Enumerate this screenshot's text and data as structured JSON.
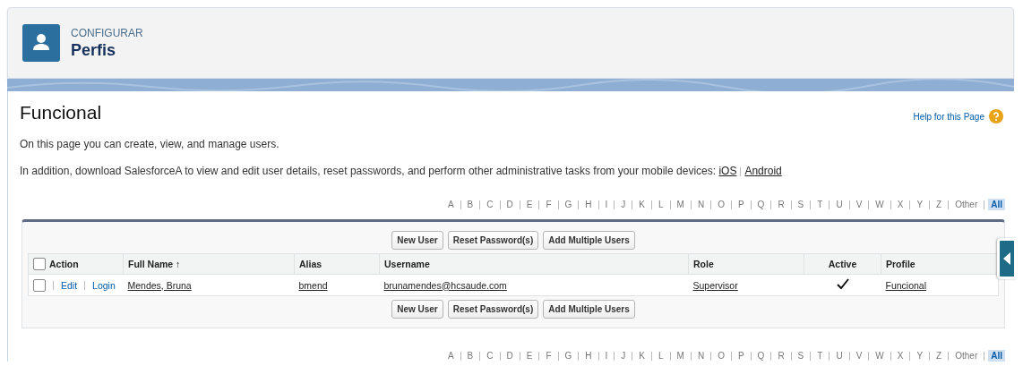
{
  "header": {
    "section": "CONFIGURAR",
    "title": "Perfis"
  },
  "page": {
    "title": "Funcional",
    "help_link": "Help for this Page",
    "intro": "On this page you can create, view, and manage users.",
    "mobile_text": "In addition, download SalesforceA to view and edit user details, reset passwords, and perform other administrative tasks from your mobile devices:",
    "mobile_links": [
      "iOS",
      "Android"
    ]
  },
  "alphabet_top": [
    {
      "label": "A",
      "selected": false
    },
    {
      "label": "B",
      "selected": false
    },
    {
      "label": "C",
      "selected": false
    },
    {
      "label": "D",
      "selected": false
    },
    {
      "label": "E",
      "selected": false
    },
    {
      "label": "F",
      "selected": false
    },
    {
      "label": "G",
      "selected": false
    },
    {
      "label": "H",
      "selected": false
    },
    {
      "label": "I",
      "selected": false
    },
    {
      "label": "J",
      "selected": false
    },
    {
      "label": "K",
      "selected": false
    },
    {
      "label": "L",
      "selected": false
    },
    {
      "label": "M",
      "selected": false
    },
    {
      "label": "N",
      "selected": false
    },
    {
      "label": "O",
      "selected": false
    },
    {
      "label": "P",
      "selected": false
    },
    {
      "label": "Q",
      "selected": false
    },
    {
      "label": "R",
      "selected": false
    },
    {
      "label": "S",
      "selected": false
    },
    {
      "label": "T",
      "selected": false
    },
    {
      "label": "U",
      "selected": false
    },
    {
      "label": "V",
      "selected": false
    },
    {
      "label": "W",
      "selected": false
    },
    {
      "label": "X",
      "selected": false
    },
    {
      "label": "Y",
      "selected": false
    },
    {
      "label": "Z",
      "selected": false
    },
    {
      "label": "Other",
      "selected": false
    },
    {
      "label": "All",
      "selected": true
    }
  ],
  "buttons_top": [
    "New User",
    "Reset Password(s)",
    "Add Multiple Users"
  ],
  "table": {
    "select_all_checked": false,
    "columns": [
      "Action",
      "Full Name ↑",
      "Alias",
      "Username",
      "Role",
      "Active",
      "Profile"
    ],
    "rows": [
      {
        "checked": false,
        "actions": [
          "Edit",
          "Login"
        ],
        "full_name": "Mendes, Bruna",
        "alias": "bmend",
        "username": "brunamendes@hcsaude.com",
        "role": "Supervisor",
        "active": true,
        "profile": "Funcional"
      }
    ]
  },
  "buttons_bottom": [
    "New User",
    "Reset Password(s)",
    "Add Multiple Users"
  ],
  "alphabet_bottom": [
    {
      "label": "A",
      "selected": false
    },
    {
      "label": "B",
      "selected": false
    },
    {
      "label": "C",
      "selected": false
    },
    {
      "label": "D",
      "selected": false
    },
    {
      "label": "E",
      "selected": false
    },
    {
      "label": "F",
      "selected": false
    },
    {
      "label": "G",
      "selected": false
    },
    {
      "label": "H",
      "selected": false
    },
    {
      "label": "I",
      "selected": false
    },
    {
      "label": "J",
      "selected": false
    },
    {
      "label": "K",
      "selected": false
    },
    {
      "label": "L",
      "selected": false
    },
    {
      "label": "M",
      "selected": false
    },
    {
      "label": "N",
      "selected": false
    },
    {
      "label": "O",
      "selected": false
    },
    {
      "label": "P",
      "selected": false
    },
    {
      "label": "Q",
      "selected": false
    },
    {
      "label": "R",
      "selected": false
    },
    {
      "label": "S",
      "selected": false
    },
    {
      "label": "T",
      "selected": false
    },
    {
      "label": "U",
      "selected": false
    },
    {
      "label": "V",
      "selected": false
    },
    {
      "label": "W",
      "selected": false
    },
    {
      "label": "X",
      "selected": false
    },
    {
      "label": "Y",
      "selected": false
    },
    {
      "label": "Z",
      "selected": false
    },
    {
      "label": "Other",
      "selected": false
    },
    {
      "label": "All",
      "selected": true
    }
  ]
}
